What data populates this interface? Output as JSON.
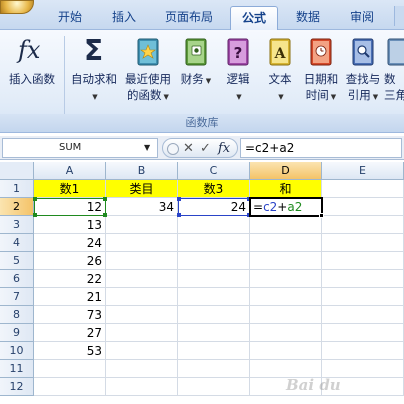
{
  "ribbon": {
    "tabs": [
      {
        "label": "开始"
      },
      {
        "label": "插入"
      },
      {
        "label": "页面布局"
      },
      {
        "label": "公式"
      },
      {
        "label": "数据"
      },
      {
        "label": "审阅"
      }
    ],
    "buttons": {
      "insert_function": {
        "l1": "插入函数",
        "icon_text": "fx"
      },
      "autosum": {
        "l1": "自动求和",
        "icon_text": "Σ"
      },
      "recent": {
        "l1": "最近使用",
        "l2": "的函数"
      },
      "financial": {
        "l1": "财务"
      },
      "logical": {
        "l1": "逻辑"
      },
      "text": {
        "l1": "文本"
      },
      "datetime": {
        "l1": "日期和",
        "l2": "时间"
      },
      "lookup": {
        "l1": "查找与",
        "l2": "引用"
      },
      "math": {
        "l1": "数",
        "l2": "三角"
      }
    },
    "group_label": "函数库"
  },
  "formula_bar": {
    "name_box": "SUM",
    "formula": "=c2+a2"
  },
  "sheet": {
    "columns": [
      "A",
      "B",
      "C",
      "D",
      "E"
    ],
    "rows": [
      "1",
      "2",
      "3",
      "4",
      "5",
      "6",
      "7",
      "8",
      "9",
      "10",
      "11",
      "12"
    ],
    "header_row": [
      "数1",
      "类目",
      "数3",
      "和"
    ],
    "row2": {
      "a": "12",
      "b": "34",
      "c": "24",
      "d_eq": "=",
      "d_c": "c2",
      "d_plus": "+",
      "d_a": "a2"
    },
    "col_a": [
      "13",
      "24",
      "26",
      "22",
      "21",
      "73",
      "27",
      "53"
    ]
  },
  "watermark": "Bai du"
}
